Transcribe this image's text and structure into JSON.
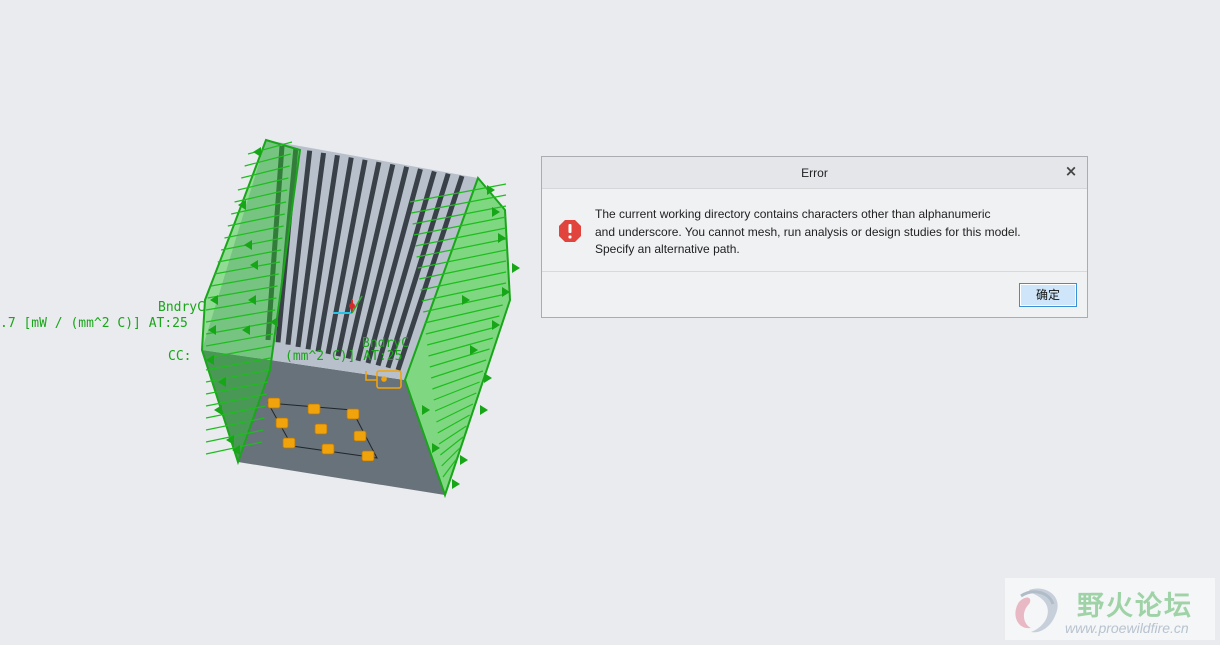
{
  "viewport": {
    "labels": {
      "bndry_top": "BndryC",
      "heat_coeff": ".7 [mW / (mm^2 C)] AT:25",
      "cc_left": "CC:",
      "cc_mid": "(mm^2 C)] AT:25",
      "bndry_right": "BndryC"
    }
  },
  "dialog": {
    "title": "Error",
    "close_glyph": "×",
    "message_lines": [
      "The current working directory contains characters other than alphanumeric",
      "and underscore. You cannot mesh, run analysis or design studies for this model.",
      "Specify an alternative path."
    ],
    "ok_label": "确定"
  },
  "watermark": {
    "name": "野火论坛",
    "url": "www.proewildfire.cn"
  },
  "colors": {
    "background": "#e9ebee",
    "fin_green": "#19b21a",
    "body_gray": "#6c7780",
    "chip_orange": "#f1a30c",
    "error_red": "#e0443c",
    "button_border": "#3a8fd6"
  }
}
